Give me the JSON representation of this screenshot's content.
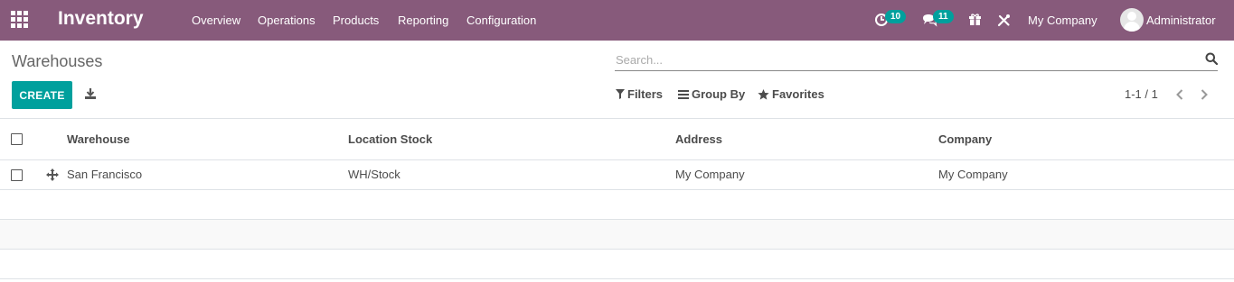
{
  "navbar": {
    "app_title": "Inventory",
    "menu": {
      "overview": "Overview",
      "operations": "Operations",
      "products": "Products",
      "reporting": "Reporting",
      "configuration": "Configuration"
    },
    "activity_count": "10",
    "messages_count": "11",
    "company": "My Company",
    "user": "Administrator",
    "icons": [
      "apps-grid-icon",
      "clock-activity-icon",
      "chat-messages-icon",
      "gift-icon",
      "tools-debug-icon",
      "user-avatar"
    ]
  },
  "control_panel": {
    "breadcrumb": "Warehouses",
    "search_placeholder": "Search...",
    "create_label": "CREATE",
    "filters_label": "Filters",
    "group_by_label": "Group By",
    "favorites_label": "Favorites",
    "pager_label": "1-1 / 1"
  },
  "table": {
    "columns": {
      "warehouse": "Warehouse",
      "location_stock": "Location Stock",
      "address": "Address",
      "company": "Company"
    },
    "rows": [
      {
        "warehouse": "San Francisco",
        "location_stock": "WH/Stock",
        "address": "My Company",
        "company": "My Company"
      }
    ]
  },
  "colors": {
    "navbar": "#875a7b",
    "primary_button": "#00a09d",
    "badge": "#00a09d"
  }
}
